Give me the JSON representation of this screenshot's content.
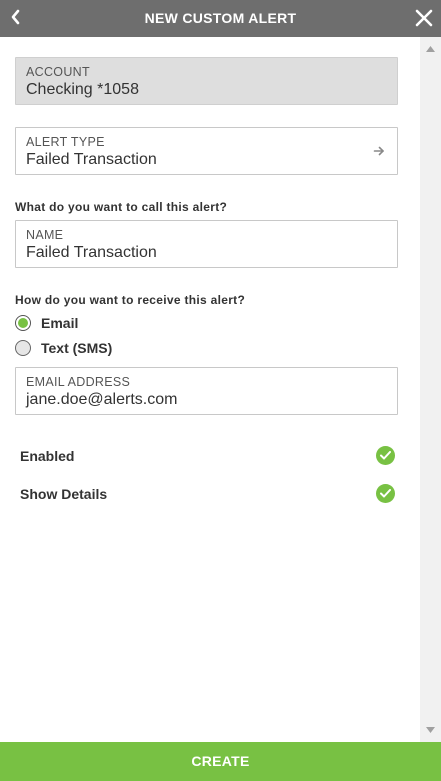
{
  "header": {
    "title": "NEW CUSTOM ALERT",
    "back_icon": "chevron-left-icon",
    "close_icon": "close-icon",
    "background": "#6e6e6e"
  },
  "account": {
    "label": "ACCOUNT",
    "value": "Checking *1058"
  },
  "alert_type": {
    "label": "ALERT TYPE",
    "value": "Failed Transaction",
    "icon": "arrow-right-icon"
  },
  "name_section": {
    "question": "What do you want to call this alert?",
    "label": "NAME",
    "value": "Failed Transaction"
  },
  "delivery": {
    "question": "How do you want to receive this alert?",
    "options": [
      {
        "label": "Email",
        "selected": true
      },
      {
        "label": "Text (SMS)",
        "selected": false
      }
    ],
    "email_label": "EMAIL ADDRESS",
    "email_value": "jane.doe@alerts.com"
  },
  "toggles": [
    {
      "label": "Enabled",
      "checked": true
    },
    {
      "label": "Show Details",
      "checked": true
    }
  ],
  "footer": {
    "create_label": "CREATE",
    "color": "#78c143"
  }
}
